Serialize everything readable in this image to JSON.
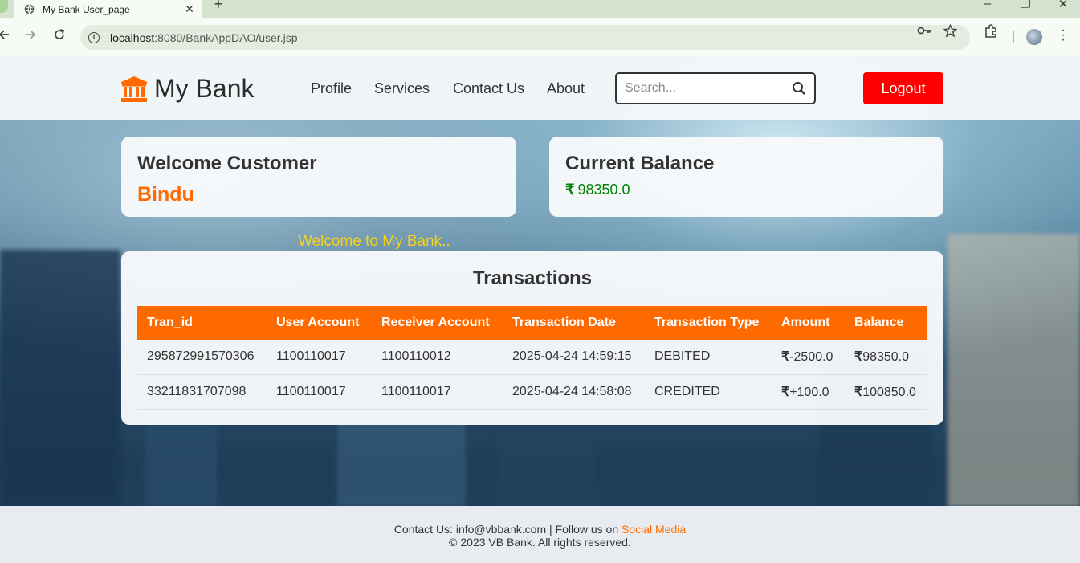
{
  "browser": {
    "tab_title": "My Bank User_page",
    "tab_close": "✕",
    "new_tab": "+",
    "url_host": "localhost",
    "url_path": ":8080/BankAppDAO/user.jsp"
  },
  "header": {
    "brand": "My Bank",
    "nav": [
      "Profile",
      "Services",
      "Contact Us",
      "About"
    ],
    "search_placeholder": "Search...",
    "logout_label": "Logout"
  },
  "welcome": {
    "title": "Welcome Customer",
    "name": "Bindu"
  },
  "balance": {
    "title": "Current Balance",
    "currency": "₹",
    "value": "98350.0"
  },
  "marquee": "Welcome to My Bank..",
  "transactions": {
    "title": "Transactions",
    "columns": [
      "Tran_id",
      "User Account",
      "Receiver Account",
      "Transaction Date",
      "Transaction Type",
      "Amount",
      "Balance"
    ],
    "rows": [
      {
        "tran_id": "295872991570306",
        "user_account": "1100110017",
        "receiver_account": "1100110012",
        "date": "2025-04-24 14:59:15",
        "type": "DEBITED",
        "amount": "-2500.0",
        "balance": "98350.0"
      },
      {
        "tran_id": "33211831707098",
        "user_account": "1100110017",
        "receiver_account": "1100110017",
        "date": "2025-04-24 14:58:08",
        "type": "CREDITED",
        "amount": "+100.0",
        "balance": "100850.0"
      }
    ]
  },
  "footer": {
    "contact_prefix": "Contact Us: info@vbbank.com | Follow us on ",
    "social_link": "Social Media",
    "copyright": "© 2023 VB Bank. All rights reserved."
  },
  "colors": {
    "accent": "#ff6a00",
    "logout": "#ff0000",
    "credit": "#008000",
    "debit": "#e00000",
    "marquee": "#f5d21a"
  },
  "icons": [
    "globe-icon",
    "back-icon",
    "forward-icon",
    "reload-icon",
    "site-info-icon",
    "password-key-icon",
    "bookmark-star-icon",
    "extensions-icon",
    "profile-avatar",
    "menu-kebab-icon",
    "bank-icon",
    "search-icon"
  ]
}
